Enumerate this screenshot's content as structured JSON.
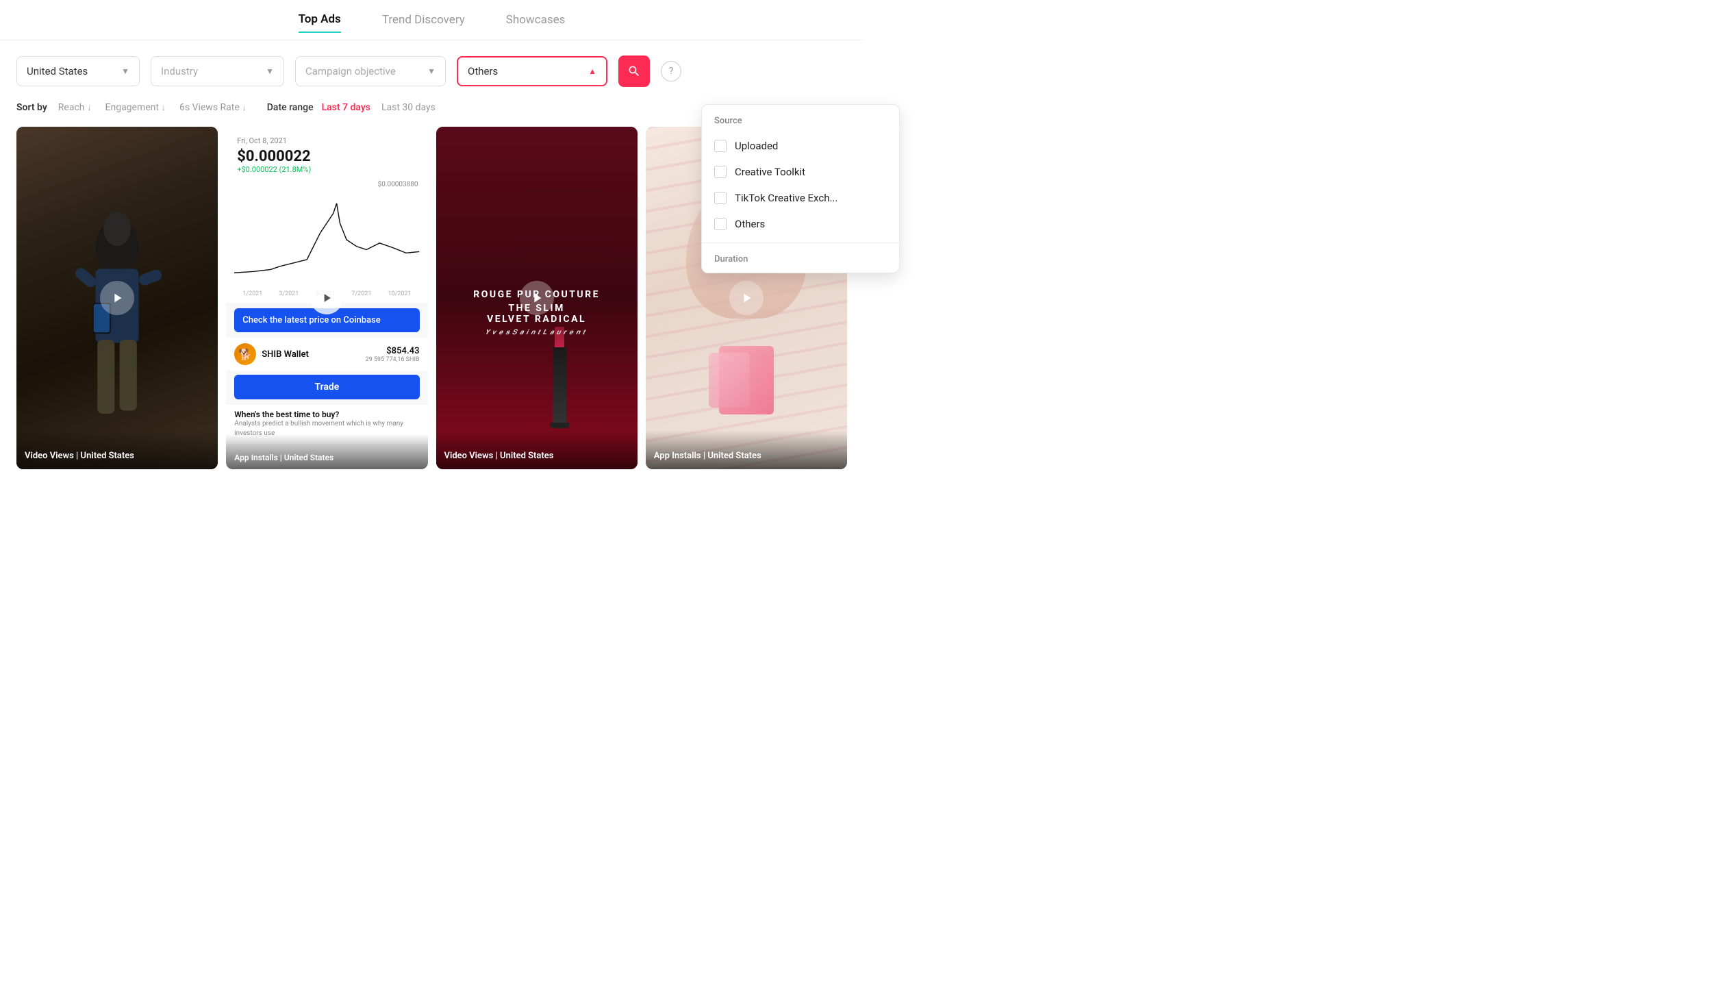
{
  "nav": {
    "items": [
      {
        "label": "Top Ads",
        "active": true
      },
      {
        "label": "Trend Discovery",
        "active": false
      },
      {
        "label": "Showcases",
        "active": false
      }
    ]
  },
  "filters": {
    "country": {
      "label": "United States",
      "placeholder": "United States"
    },
    "industry": {
      "label": "Industry",
      "placeholder": "Industry"
    },
    "campaign": {
      "label": "Campaign objective",
      "placeholder": "Campaign objective"
    },
    "others": {
      "label": "Others",
      "placeholder": "Others"
    },
    "search_label": "Search",
    "help_label": "?"
  },
  "sort": {
    "label": "Sort by",
    "options": [
      {
        "label": "Reach"
      },
      {
        "label": "Engagement"
      },
      {
        "label": "6s Views Rate"
      }
    ],
    "date_range_label": "Date range",
    "date_options": [
      {
        "label": "Last 7 days",
        "active": true
      },
      {
        "label": "Last 30 days",
        "active": false
      }
    ]
  },
  "dropdown": {
    "source_title": "Source",
    "items": [
      {
        "label": "Uploaded"
      },
      {
        "label": "Creative Toolkit"
      },
      {
        "label": "TikTok Creative Exch..."
      },
      {
        "label": "Others"
      }
    ],
    "duration_label": "Duration"
  },
  "cards": [
    {
      "footer": "Video Views | United States",
      "type": "dark"
    },
    {
      "date": "Fri, Oct 8, 2021",
      "price": "$0.000022",
      "change": "+$0.000022 (21.8M%)",
      "chart_max": "$0.00003880",
      "chart_labels": [
        "1/2021",
        "3/2021",
        "5/2021",
        "7/2021",
        "10/2021"
      ],
      "blue_box_text": "Check the latest price on Coinbase",
      "token_name": "SHIB Wallet",
      "token_usd": "$854.43",
      "token_qty": "29 595 774,16 SHIB",
      "trade_label": "Trade",
      "bottom_title": "When's the best time to buy?",
      "bottom_text": "Analysts predict a bullish movement which is why many investors use",
      "footer": "App Installs | United States",
      "type": "light"
    },
    {
      "line1": "ROUGE PUR COUTURE",
      "line2": "THE SLIM",
      "line3": "VELVET RADICAL",
      "brand": "YvesSaintLaurent",
      "footer": "Video Views | United States",
      "type": "dark"
    },
    {
      "footer": "App Installs | United States",
      "type": "light-warm"
    }
  ]
}
